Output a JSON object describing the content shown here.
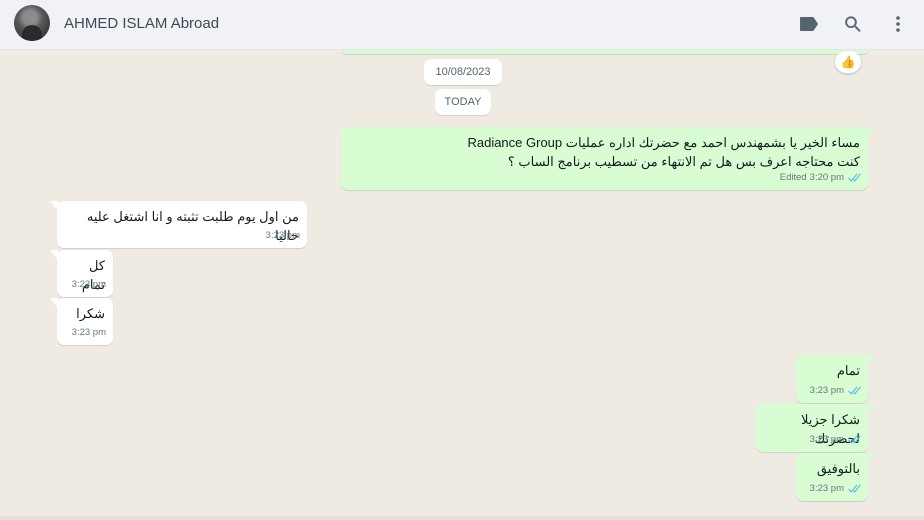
{
  "header": {
    "contact_name": "AHMED ISLAM Abroad",
    "icons": [
      "label-icon",
      "search-icon",
      "menu-icon"
    ]
  },
  "chat": {
    "reaction": "👍",
    "date_chips": [
      "10/08/2023",
      "TODAY"
    ],
    "messages": [
      {
        "direction": "out",
        "lines": [
          "مساء الخير يا بشمهندس احمد مع حضرتك اداره عمليات Radiance Group",
          "كنت محتاجه اعرف بس هل تم الانتهاء من تسطيب برنامج الساب ؟"
        ],
        "edited": "Edited",
        "time": "3:20 pm"
      },
      {
        "direction": "in",
        "text": "من اول يوم طلبت تثبته و انا اشتغل عليه حاليا",
        "time": "3:23 pm"
      },
      {
        "direction": "in",
        "text": "كل تمام",
        "time": "3:23 pm"
      },
      {
        "direction": "in",
        "text": "شكرا",
        "time": "3:23 pm"
      },
      {
        "direction": "out",
        "text": "تمام",
        "time": "3:23 pm"
      },
      {
        "direction": "out",
        "text": "شكرا جزيلا لحضرتك",
        "time": "3:23 pm"
      },
      {
        "direction": "out",
        "text": "بالتوفيق",
        "time": "3:23 pm"
      }
    ]
  },
  "colors": {
    "outgoing_bubble": "#d9fdd3",
    "incoming_bubble": "#ffffff",
    "read_ticks": "#53bdeb",
    "chat_background": "#efeae2"
  }
}
